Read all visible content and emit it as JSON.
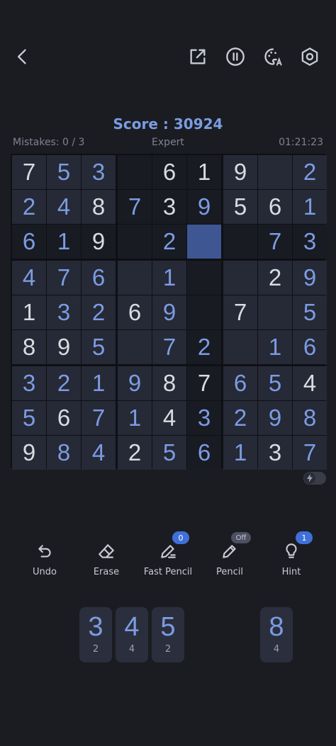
{
  "header": {
    "icons": [
      "back-arrow-icon",
      "share-icon",
      "pause-icon",
      "theme-palette-icon",
      "settings-icon"
    ]
  },
  "status": {
    "score_text": "Score : 30924",
    "mistakes_text": "Mistakes: 0 / 3",
    "difficulty": "Expert",
    "timer": "01:21:23"
  },
  "board": {
    "selected": [
      2,
      5
    ],
    "rows": [
      [
        "7",
        "5",
        "3",
        "",
        "6",
        "1",
        "9",
        "",
        "2"
      ],
      [
        "2",
        "4",
        "8",
        "7",
        "3",
        "9",
        "5",
        "6",
        "1"
      ],
      [
        "6",
        "1",
        "9",
        "",
        "2",
        "",
        "",
        "7",
        "3"
      ],
      [
        "4",
        "7",
        "6",
        "",
        "1",
        "",
        "",
        "2",
        "9"
      ],
      [
        "1",
        "3",
        "2",
        "6",
        "9",
        "",
        "7",
        "",
        "5"
      ],
      [
        "8",
        "9",
        "5",
        "",
        "7",
        "2",
        "",
        "1",
        "6"
      ],
      [
        "3",
        "2",
        "1",
        "9",
        "8",
        "7",
        "6",
        "5",
        "4"
      ],
      [
        "5",
        "6",
        "7",
        "1",
        "4",
        "3",
        "2",
        "9",
        "8"
      ],
      [
        "9",
        "8",
        "4",
        "2",
        "5",
        "6",
        "1",
        "3",
        "7"
      ]
    ],
    "kinds": [
      [
        "g",
        "u",
        "u",
        "",
        "g",
        "g",
        "g",
        "",
        "u"
      ],
      [
        "u",
        "u",
        "g",
        "u",
        "g",
        "u",
        "g",
        "g",
        "u"
      ],
      [
        "u",
        "u",
        "g",
        "",
        "u",
        "",
        "",
        "u",
        "u"
      ],
      [
        "u",
        "u",
        "u",
        "",
        "u",
        "",
        "",
        "g",
        "u"
      ],
      [
        "g",
        "u",
        "u",
        "g",
        "u",
        "",
        "g",
        "",
        "u"
      ],
      [
        "g",
        "g",
        "u",
        "",
        "u",
        "u",
        "",
        "u",
        "u"
      ],
      [
        "u",
        "u",
        "u",
        "u",
        "g",
        "g",
        "u",
        "u",
        "g"
      ],
      [
        "u",
        "g",
        "u",
        "u",
        "g",
        "u",
        "u",
        "u",
        "u"
      ],
      [
        "g",
        "u",
        "u",
        "g",
        "u",
        "u",
        "u",
        "g",
        "u"
      ]
    ]
  },
  "toggle": {
    "icon": "lightning-icon",
    "on": false
  },
  "tools": [
    {
      "label": "Undo",
      "icon": "undo-icon"
    },
    {
      "label": "Erase",
      "icon": "eraser-icon"
    },
    {
      "label": "Fast Pencil",
      "icon": "fast-pencil-icon",
      "badge": "0"
    },
    {
      "label": "Pencil",
      "icon": "pencil-icon",
      "badge": "Off"
    },
    {
      "label": "Hint",
      "icon": "lightbulb-icon",
      "badge": "1"
    }
  ],
  "numpad": [
    {
      "digit": "3",
      "count": "2"
    },
    {
      "digit": "4",
      "count": "4"
    },
    {
      "digit": "5",
      "count": "2"
    },
    {
      "digit": "8",
      "count": "4"
    }
  ],
  "colors": {
    "background": "#1b1c21",
    "accent": "#7b9ce3",
    "selected_cell": "#3e5793",
    "badge": "#3f70d9"
  }
}
